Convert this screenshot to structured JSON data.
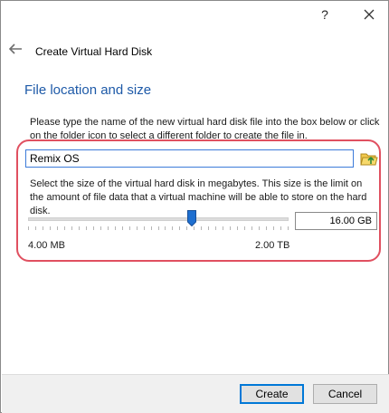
{
  "titlebar": {
    "help_label": "?"
  },
  "wizard": {
    "title": "Create Virtual Hard Disk",
    "section_title": "File location and size",
    "location_description": "Please type the name of the new virtual hard disk file into the box below or click on the folder icon to select a different folder to create the file in.",
    "file_name_value": "Remix OS",
    "size_description": "Select the size of the virtual hard disk in megabytes. This size is the limit on the amount of file data that a virtual machine will be able to store on the hard disk.",
    "size_value": "16.00 GB",
    "slider_position": 0.63,
    "min_label": "4.00 MB",
    "max_label": "2.00 TB"
  },
  "buttons": {
    "create": "Create",
    "cancel": "Cancel"
  },
  "colors": {
    "section_title": "#1e5aa8",
    "highlight_outline": "#e05060",
    "slider_thumb": "#1e6fd0",
    "focus_border": "#0078d7"
  },
  "icons": {
    "help": "help-icon",
    "close": "close-icon",
    "back": "back-arrow-icon",
    "folder": "folder-icon"
  }
}
